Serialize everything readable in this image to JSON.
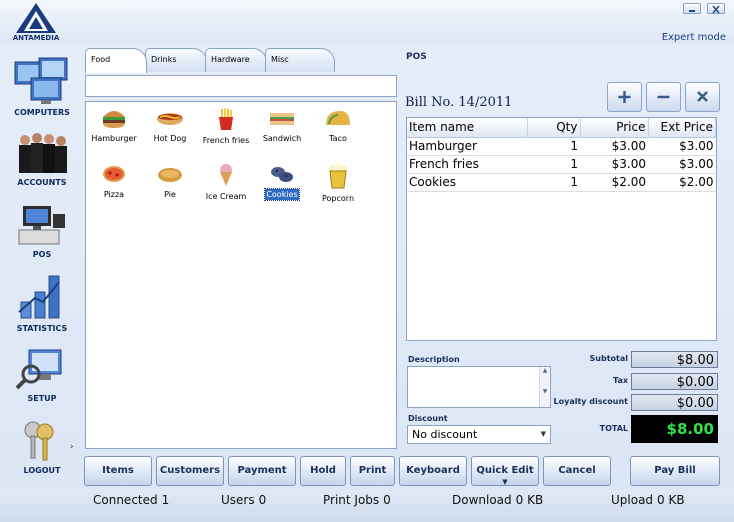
{
  "app": {
    "logo_text": "ANTAMEDIA",
    "mode": "Expert mode"
  },
  "sidebar": {
    "items": [
      {
        "label": "COMPUTERS",
        "icon": "computers-icon"
      },
      {
        "label": "ACCOUNTS",
        "icon": "accounts-icon"
      },
      {
        "label": "POS",
        "icon": "pos-icon"
      },
      {
        "label": "STATISTICS",
        "icon": "statistics-icon"
      },
      {
        "label": "SETUP",
        "icon": "setup-icon"
      },
      {
        "label": "LOGOUT",
        "icon": "keys-icon"
      }
    ]
  },
  "tabs": [
    {
      "label": "Food",
      "active": true
    },
    {
      "label": "Drinks"
    },
    {
      "label": "Hardware"
    },
    {
      "label": "Misc"
    }
  ],
  "products": [
    {
      "label": "Hamburger",
      "icon": "hamburger-icon"
    },
    {
      "label": "Hot Dog",
      "icon": "hot-dog-icon"
    },
    {
      "label": "French fries",
      "icon": "french-fries-icon"
    },
    {
      "label": "Sandwich",
      "icon": "sandwich-icon"
    },
    {
      "label": "Taco",
      "icon": "taco-icon"
    },
    {
      "label": "Pizza",
      "icon": "pizza-icon"
    },
    {
      "label": "Pie",
      "icon": "pie-icon"
    },
    {
      "label": "Ice Cream",
      "icon": "ice-cream-icon"
    },
    {
      "label": "Cookies",
      "icon": "cookies-icon",
      "selected": true
    },
    {
      "label": "Popcorn",
      "icon": "popcorn-icon"
    }
  ],
  "pos": {
    "title": "POS",
    "bill_no": "Bill No. 14/2011",
    "columns": [
      "Item name",
      "Qty",
      "Price",
      "Ext Price"
    ],
    "rows": [
      {
        "name": "Hamburger",
        "qty": "1",
        "price": "$3.00",
        "ext": "$3.00"
      },
      {
        "name": "French fries",
        "qty": "1",
        "price": "$3.00",
        "ext": "$3.00"
      },
      {
        "name": "Cookies",
        "qty": "1",
        "price": "$2.00",
        "ext": "$2.00"
      }
    ],
    "description_label": "Description",
    "discount_label": "Discount",
    "discount_value": "No discount",
    "subtotal_label": "Subtotal",
    "subtotal": "$8.00",
    "tax_label": "Tax",
    "tax": "$0.00",
    "loyalty_label": "Loyalty discount",
    "loyalty": "$0.00",
    "total_label": "TOTAL",
    "total": "$8.00",
    "total_color": "#2fe04a"
  },
  "toolbar": {
    "items": "Items",
    "customers": "Customers",
    "payment": "Payment",
    "hold": "Hold",
    "print": "Print",
    "keyboard": "Keyboard",
    "quick_edit": "Quick Edit",
    "cancel": "Cancel",
    "pay_bill": "Pay Bill"
  },
  "status": {
    "connected_label": "Connected",
    "connected": "1",
    "users_label": "Users",
    "users": "0",
    "print_jobs_label": "Print Jobs",
    "print_jobs": "0",
    "download_label": "Download",
    "download": "0 KB",
    "upload_label": "Upload",
    "upload": "0 KB"
  }
}
